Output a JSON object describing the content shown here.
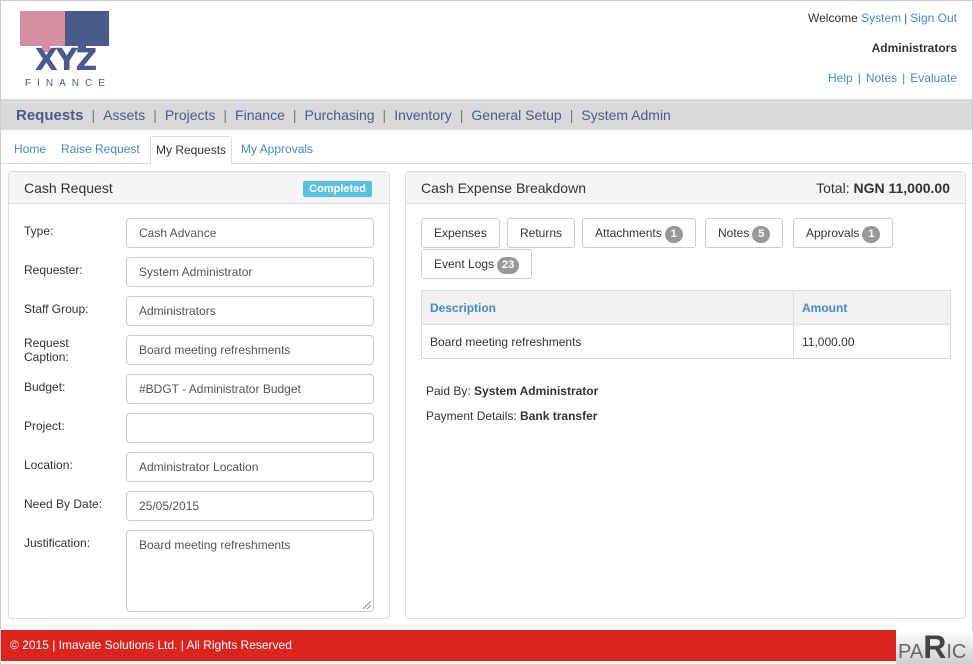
{
  "header": {
    "logo_text": "XYZ",
    "logo_subtext": "FINANCE",
    "welcome_prefix": "Welcome",
    "user_link": "System",
    "sign_out": "Sign Out",
    "role": "Administrators",
    "links": [
      "Help",
      "Notes",
      "Evaluate"
    ]
  },
  "main_nav": {
    "items": [
      "Requests",
      "Assets",
      "Projects",
      "Finance",
      "Purchasing",
      "Inventory",
      "General Setup",
      "System Admin"
    ],
    "active": "Requests"
  },
  "sub_nav": {
    "tabs": [
      "Home",
      "Raise Request",
      "My Requests",
      "My Approvals"
    ],
    "active": "My Requests"
  },
  "cash_request": {
    "title": "Cash Request",
    "status": "Completed",
    "status_color": "#5bc0de",
    "fields": [
      {
        "label": "Type:",
        "value": "Cash Advance"
      },
      {
        "label": "Requester:",
        "value": "System Administrator"
      },
      {
        "label": "Staff Group:",
        "value": "Administrators"
      },
      {
        "label": "Request Caption:",
        "value": "Board meeting refreshments"
      },
      {
        "label": "Budget:",
        "value": "#BDGT - Administrator Budget"
      },
      {
        "label": "Project:",
        "value": ""
      },
      {
        "label": "Location:",
        "value": "Administrator Location"
      },
      {
        "label": "Need By Date:",
        "value": "25/05/2015"
      },
      {
        "label": "Justification:",
        "value": "Board meeting refreshments"
      }
    ]
  },
  "breakdown": {
    "title": "Cash Expense Breakdown",
    "total_label": "Total:",
    "total_value": "NGN 11,000.00",
    "tabs": [
      {
        "label": "Expenses",
        "count": null
      },
      {
        "label": "Returns",
        "count": null
      },
      {
        "label": "Attachments",
        "count": "1"
      },
      {
        "label": "Notes",
        "count": "5"
      },
      {
        "label": "Approvals",
        "count": "1"
      },
      {
        "label": "Event Logs",
        "count": "23"
      }
    ],
    "table": {
      "columns": [
        "Description",
        "Amount"
      ],
      "rows": [
        [
          "Board meeting refreshments",
          "11,000.00"
        ]
      ]
    },
    "paid_by_label": "Paid By:",
    "paid_by_value": "System Administrator",
    "payment_details_label": "Payment Details:",
    "payment_details_value": "Bank transfer"
  },
  "footer": {
    "text": "© 2015 | Imavate Solutions Ltd. | All Rights Reserved",
    "color": "#dc241f",
    "badge_text_a": "PA",
    "badge_text_b": "R",
    "badge_text_c": "IC"
  }
}
